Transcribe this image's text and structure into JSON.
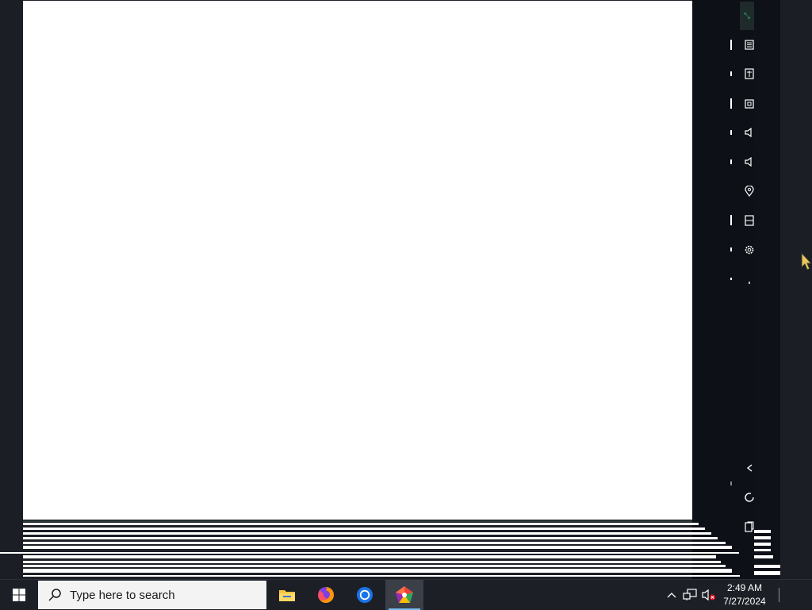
{
  "taskbar": {
    "search_placeholder": "Type here to search",
    "pinned_apps": [
      "file-explorer",
      "firefox",
      "chrome",
      "app-launcher"
    ],
    "clock_time": "2:49 AM",
    "clock_date": "7/27/2024"
  },
  "side_toolbar": {
    "icons": [
      "collapse-icon",
      "document-icon",
      "translate-icon",
      "screenshot-icon",
      "volume-icon",
      "volume-icon",
      "location-icon",
      "page-icon",
      "settings-icon",
      "more-icon",
      "back-icon",
      "circle-icon",
      "copy-icon"
    ]
  },
  "colors": {
    "taskbar_bg": "#1c2026",
    "panel_bg": "#0d1117",
    "accent": "#76b9ed"
  }
}
